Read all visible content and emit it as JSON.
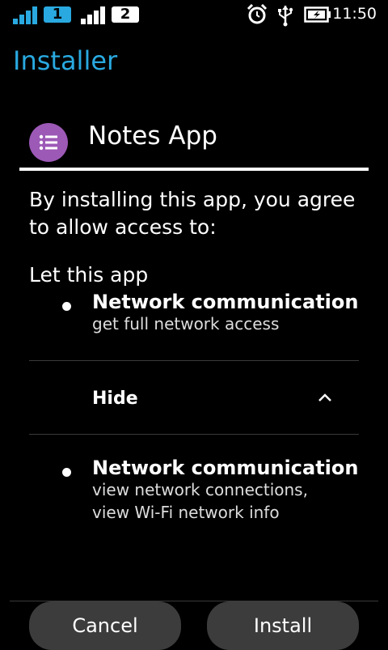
{
  "status_bar": {
    "sim1_label": "1",
    "sim2_label": "2",
    "time": "11:50",
    "icons": [
      "signal-icon",
      "signal-icon",
      "alarm-icon",
      "usb-icon",
      "battery-charging-icon"
    ],
    "accent_color": "#29a9e0"
  },
  "header": {
    "title": "Installer"
  },
  "app": {
    "name": "Notes App",
    "icon": "list-icon",
    "icon_color": "#9c59b6"
  },
  "consent": {
    "agree_text": "By installing this app, you agree to allow access to:",
    "let_text": "Let this app"
  },
  "permissions": [
    {
      "title": "Network communication",
      "description_lines": [
        "get full network access"
      ]
    },
    {
      "title": "Network communication",
      "description_lines": [
        "view network connections,",
        "view Wi-Fi network info"
      ]
    }
  ],
  "toggle": {
    "label": "Hide",
    "icon": "chevron-up-icon"
  },
  "buttons": {
    "cancel": "Cancel",
    "install": "Install"
  }
}
